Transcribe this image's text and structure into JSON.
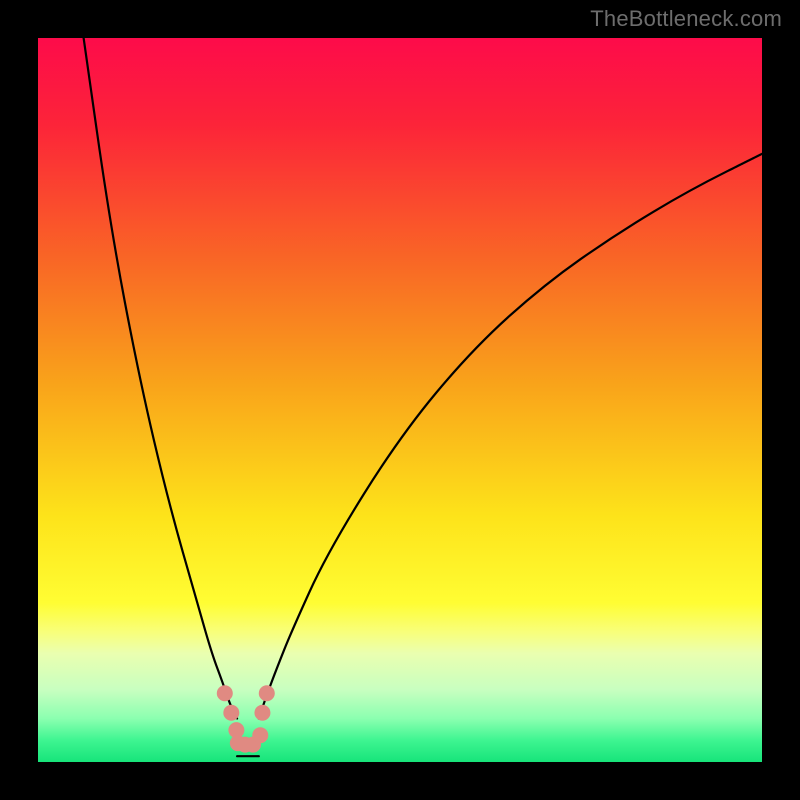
{
  "watermark": "TheBottleneck.com",
  "colors": {
    "background_black": "#000000",
    "curve": "#000000",
    "marker_fill": "#e08a82",
    "gradient_stops": [
      {
        "offset": 0.0,
        "color": "#fd0b4a"
      },
      {
        "offset": 0.12,
        "color": "#fc2439"
      },
      {
        "offset": 0.3,
        "color": "#f96426"
      },
      {
        "offset": 0.48,
        "color": "#f9a41a"
      },
      {
        "offset": 0.66,
        "color": "#fde31a"
      },
      {
        "offset": 0.78,
        "color": "#fffd33"
      },
      {
        "offset": 0.82,
        "color": "#f8ff7a"
      },
      {
        "offset": 0.85,
        "color": "#eaffb0"
      },
      {
        "offset": 0.9,
        "color": "#c8ffc0"
      },
      {
        "offset": 0.94,
        "color": "#8bffb0"
      },
      {
        "offset": 0.97,
        "color": "#3ef591"
      },
      {
        "offset": 1.0,
        "color": "#17e47a"
      }
    ]
  },
  "chart_data": {
    "type": "line",
    "title": "",
    "xlabel": "",
    "ylabel": "",
    "xlim": [
      0,
      100
    ],
    "ylim": [
      0,
      100
    ],
    "note": "x is normalized horizontal position (percent); y is normalized vertical position (percent, 0 = top). Curve is a V-shaped dip reaching the bottom around x≈29.",
    "series": [
      {
        "name": "left-branch",
        "x": [
          6.3,
          10,
          14,
          18,
          22,
          24,
          25.5,
          26.5,
          27.5
        ],
        "y": [
          0,
          26,
          47,
          64,
          78,
          85,
          89,
          92,
          94
        ]
      },
      {
        "name": "right-branch",
        "x": [
          30.5,
          31.5,
          33,
          35,
          40,
          50,
          60,
          70,
          80,
          90,
          100
        ],
        "y": [
          94,
          91,
          87,
          82,
          71,
          55,
          43,
          34,
          27,
          21,
          16
        ]
      },
      {
        "name": "trough-baseline",
        "x": [
          27.5,
          30.5
        ],
        "y": [
          99.2,
          99.2
        ]
      }
    ],
    "markers": {
      "name": "trough-markers",
      "points": [
        {
          "x": 25.8,
          "y": 90.5
        },
        {
          "x": 26.7,
          "y": 93.2
        },
        {
          "x": 27.4,
          "y": 95.6
        },
        {
          "x": 27.6,
          "y": 97.4
        },
        {
          "x": 28.6,
          "y": 97.6
        },
        {
          "x": 29.7,
          "y": 97.6
        },
        {
          "x": 30.7,
          "y": 96.3
        },
        {
          "x": 31.0,
          "y": 93.2
        },
        {
          "x": 31.6,
          "y": 90.5
        }
      ]
    }
  }
}
